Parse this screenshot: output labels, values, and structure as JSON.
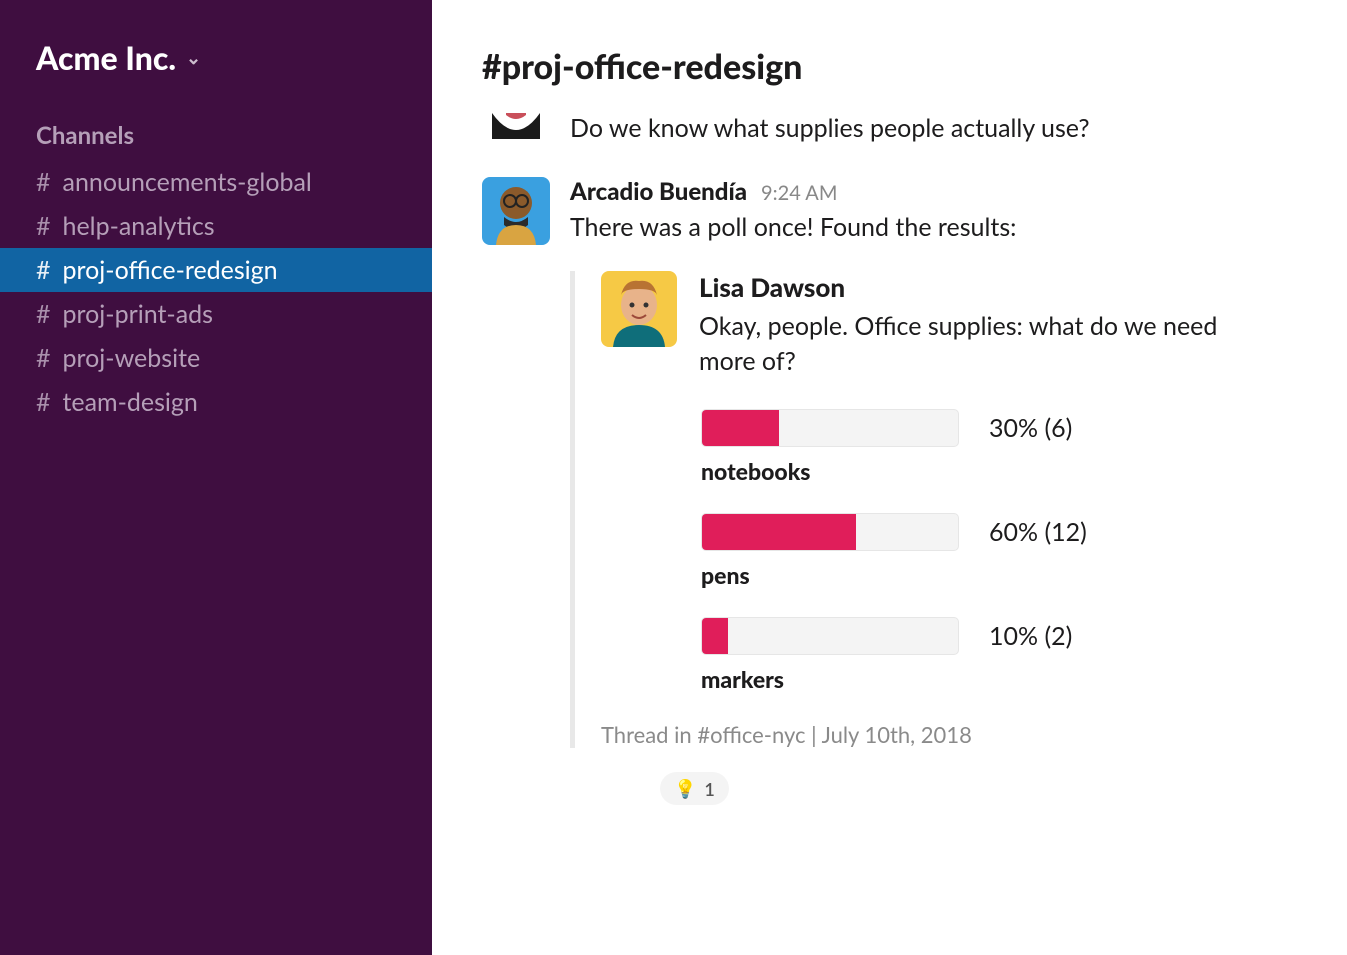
{
  "sidebar": {
    "workspace_name": "Acme Inc.",
    "channels_header": "Channels",
    "channels": [
      {
        "name": "announcements-global",
        "active": false
      },
      {
        "name": "help-analytics",
        "active": false
      },
      {
        "name": "proj-office-redesign",
        "active": true
      },
      {
        "name": "proj-print-ads",
        "active": false
      },
      {
        "name": "proj-website",
        "active": false
      },
      {
        "name": "team-design",
        "active": false
      }
    ]
  },
  "main": {
    "channel_title": "#proj-office-redesign",
    "partial_message": {
      "text": "Do we know what supplies people actually use?"
    },
    "message": {
      "author": "Arcadio Buendía",
      "time": "9:24 AM",
      "text": "There was a poll once! Found the results:",
      "attachment": {
        "author": "Lisa Dawson",
        "text": "Okay, people. Office supplies: what do we need more of?",
        "poll": [
          {
            "label": "notebooks",
            "percent": 30,
            "count": 6,
            "display": "30% (6)"
          },
          {
            "label": "pens",
            "percent": 60,
            "count": 12,
            "display": "60% (12)"
          },
          {
            "label": "markers",
            "percent": 10,
            "count": 2,
            "display": "10% (2)"
          }
        ],
        "footer": "Thread in #office-nyc | July 10th, 2018"
      }
    },
    "reaction": {
      "emoji": "💡",
      "count": "1"
    }
  }
}
